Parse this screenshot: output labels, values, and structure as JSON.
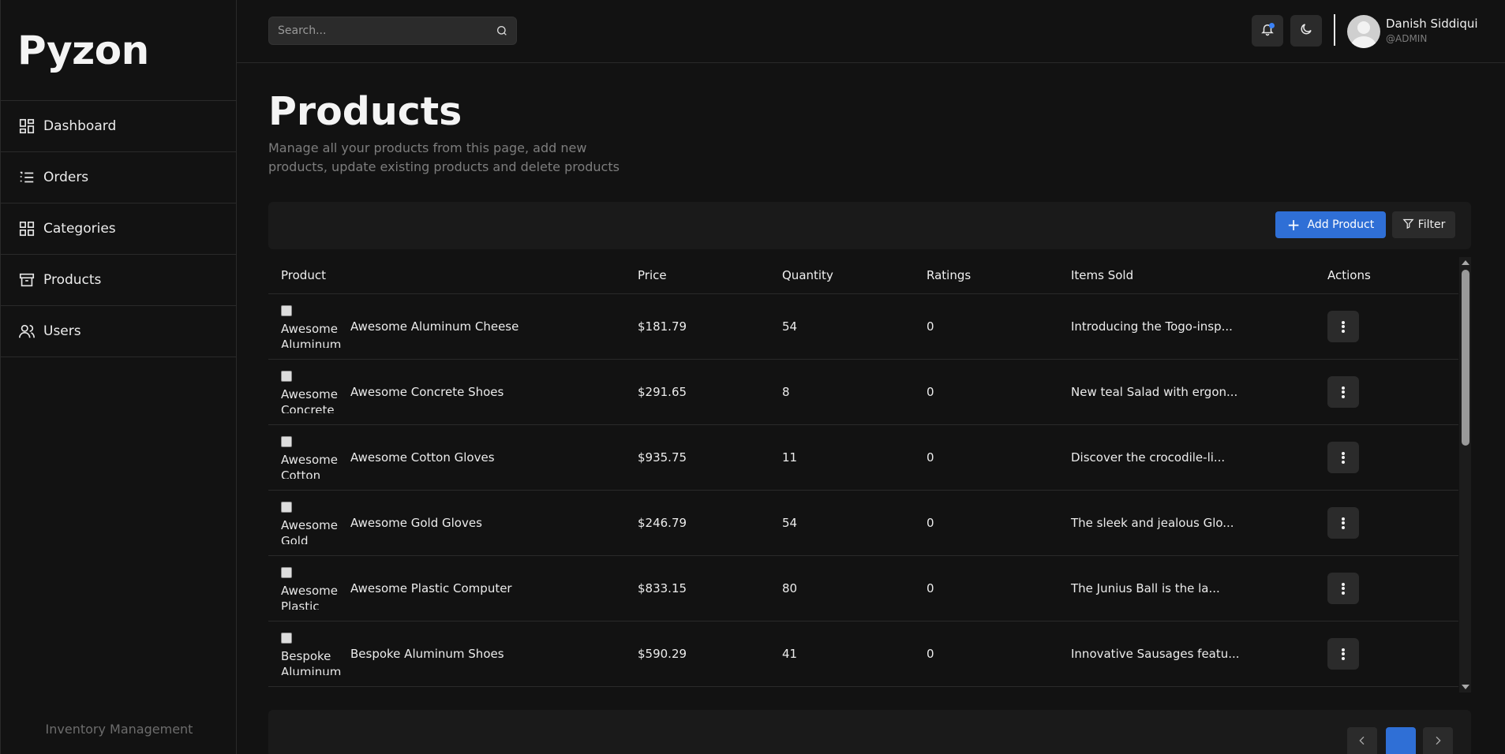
{
  "app": {
    "brand": "Pyzon",
    "footer": "Inventory Management"
  },
  "sidebar": {
    "items": [
      {
        "label": "Dashboard",
        "icon": "dashboard-icon"
      },
      {
        "label": "Orders",
        "icon": "list-icon"
      },
      {
        "label": "Categories",
        "icon": "categories-icon"
      },
      {
        "label": "Products",
        "icon": "archive-icon"
      },
      {
        "label": "Users",
        "icon": "users-icon"
      }
    ]
  },
  "topbar": {
    "search_placeholder": "Search...",
    "user_name": "Danish Siddiqui",
    "user_role": "@ADMIN"
  },
  "page": {
    "title": "Products",
    "description": "Manage all your products from this page, add new products, update existing products and delete products"
  },
  "toolbar": {
    "add_label": "Add Product",
    "filter_label": "Filter"
  },
  "table": {
    "columns": [
      "Product",
      "Price",
      "Quantity",
      "Ratings",
      "Items Sold",
      "Actions"
    ],
    "rows": [
      {
        "thumb_alt": "Awesome Aluminum Cheese",
        "name": "Awesome Aluminum Cheese",
        "price": "$181.79",
        "quantity": "54",
        "ratings": "0",
        "items_sold": "Introducing the Togo-insp..."
      },
      {
        "thumb_alt": "Awesome Concrete Shoes",
        "name": "Awesome Concrete Shoes",
        "price": "$291.65",
        "quantity": "8",
        "ratings": "0",
        "items_sold": "New teal Salad with ergon..."
      },
      {
        "thumb_alt": "Awesome Cotton Gloves",
        "name": "Awesome Cotton Gloves",
        "price": "$935.75",
        "quantity": "11",
        "ratings": "0",
        "items_sold": "Discover the crocodile-li..."
      },
      {
        "thumb_alt": "Awesome Gold Gloves",
        "name": "Awesome Gold Gloves",
        "price": "$246.79",
        "quantity": "54",
        "ratings": "0",
        "items_sold": "The sleek and jealous Glo..."
      },
      {
        "thumb_alt": "Awesome Plastic Computer",
        "name": "Awesome Plastic Computer",
        "price": "$833.15",
        "quantity": "80",
        "ratings": "0",
        "items_sold": "The Junius Ball is the la..."
      },
      {
        "thumb_alt": "Bespoke Aluminum Shoes",
        "name": "Bespoke Aluminum Shoes",
        "price": "$590.29",
        "quantity": "41",
        "ratings": "0",
        "items_sold": "Innovative Sausages featu..."
      }
    ]
  },
  "colors": {
    "accent": "#2f6fd6",
    "background": "#121212",
    "surface": "#1a1a1a"
  }
}
